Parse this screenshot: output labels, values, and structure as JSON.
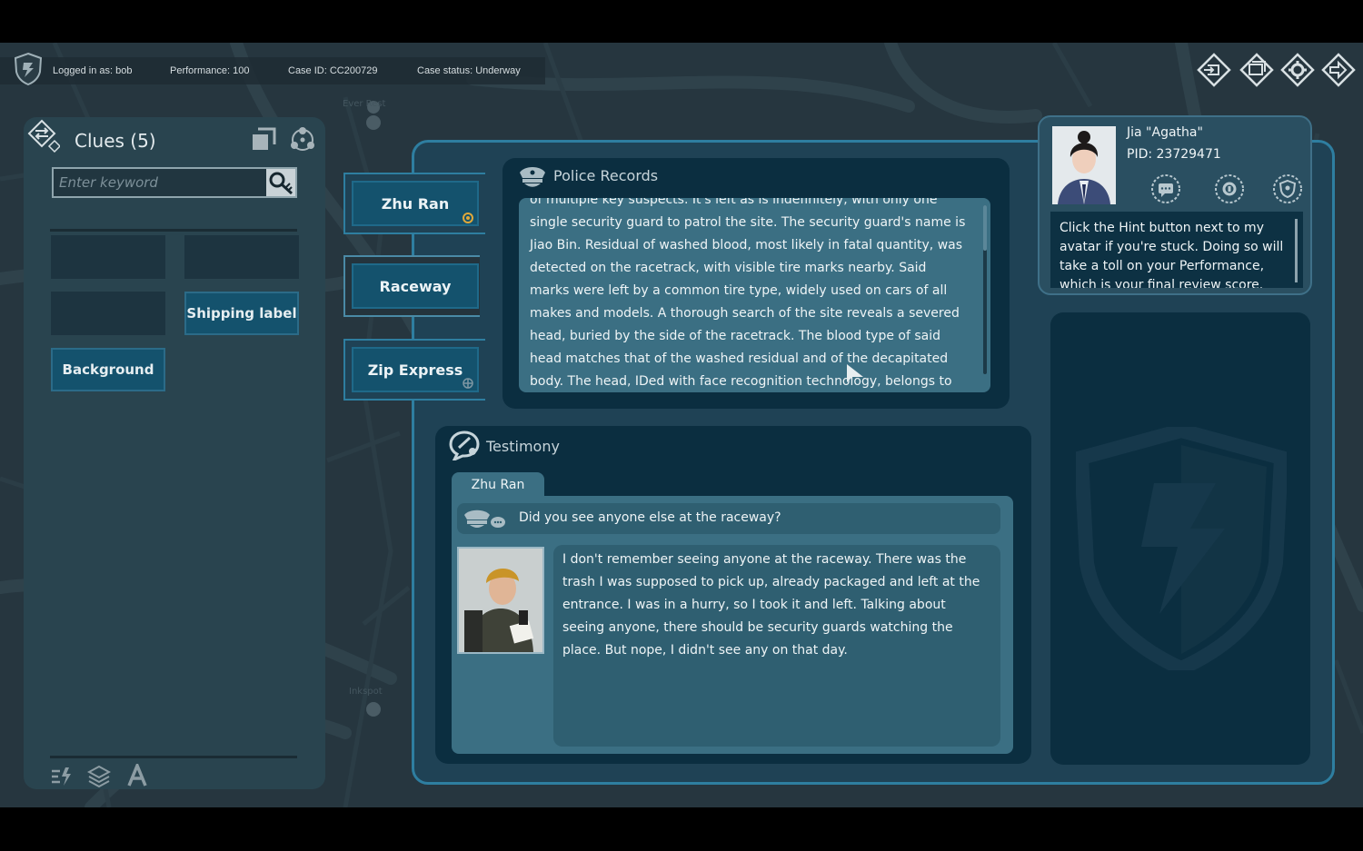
{
  "topbar": {
    "logged_in": "Logged in as: bob",
    "performance": "Performance: 100",
    "case_id": "Case ID: CC200729",
    "case_status": "Case status: Underway",
    "icons": [
      "login-icon",
      "window-icon",
      "gear-icon",
      "exit-icon"
    ]
  },
  "map": {
    "labels": [
      "Ever Rest",
      "Inkspot"
    ]
  },
  "clues": {
    "title": "Clues (5)",
    "search_placeholder": "Enter keyword",
    "items": [
      "Shipping label",
      "Background"
    ]
  },
  "suspects": [
    {
      "label": "Zhu Ran"
    },
    {
      "label": "Raceway"
    },
    {
      "label": "Zip Express"
    }
  ],
  "police_records": {
    "title": "Police Records",
    "text": "of multiple key suspects. It's left as is indefinitely, with only one single security guard to patrol the site. The security guard's name is Jiao Bin. Residual of washed blood, most likely in fatal quantity, was detected on the racetrack, with visible tire marks nearby. Said marks were left by a common tire type, widely used on cars of all makes and models. A thorough search of the site reveals a severed head, buried by the side of the racetrack. The blood type of said head matches that of the washed residual and of the decapitated body. The head, IDed with face recognition technology, belongs to Sun Guoqiang, a local taxi driver."
  },
  "testimony": {
    "title": "Testimony",
    "tab": "Zhu Ran",
    "question": "Did you see anyone else at the raceway?",
    "answer": "I don't remember seeing anyone at the raceway. There was the trash I was supposed to pick up, already packaged and left at the entrance. I was in a hurry, so I took it and left. Talking about seeing anyone, there should be security guards watching the place. But nope, I didn't see any on that day."
  },
  "profile": {
    "name": "Jia \"Agatha\"",
    "pid": "PID: 23729471",
    "hint": "Click the Hint button next to my avatar if you're stuck. Doing so will take a toll on your Performance, which is your final review score."
  },
  "colors": {
    "accent": "#2e7ea0",
    "panel_dark": "#0b2e40",
    "text_box": "#3b6f83",
    "button": "#14526d"
  }
}
